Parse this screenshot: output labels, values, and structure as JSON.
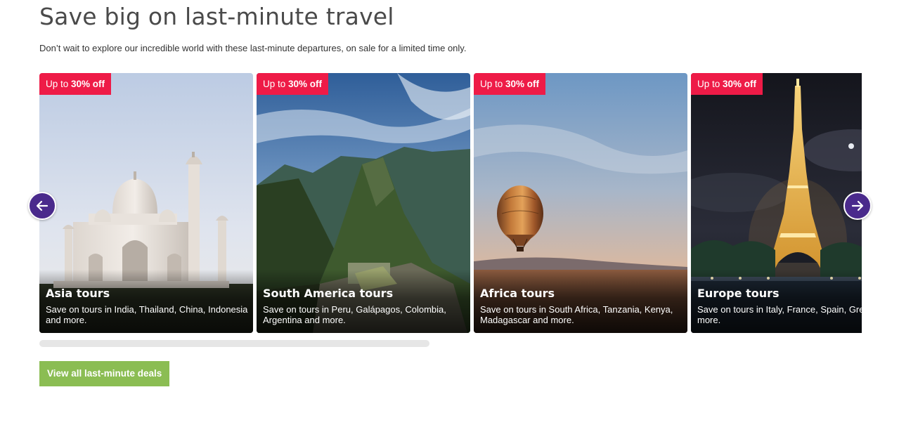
{
  "section": {
    "title": "Save big on last-minute travel",
    "subtitle": "Don’t wait to explore our incredible world with these last-minute departures, on sale for a limited time only."
  },
  "colors": {
    "badge": "#ee1b47",
    "arrow": "#4a2a8c",
    "cta": "#8bbd53",
    "scrollbar": "#e6e6e6"
  },
  "carousel": {
    "prev_icon": "arrow-left-icon",
    "next_icon": "arrow-right-icon",
    "cards": [
      {
        "badge_prefix": "Up to ",
        "badge_amount": "30% off",
        "title": "Asia tours",
        "description": "Save on tours in India, Thailand, China, Indonesia and more.",
        "image": "Taj Mahal"
      },
      {
        "badge_prefix": "Up to ",
        "badge_amount": "30% off",
        "title": "South America tours",
        "description": "Save on tours in Peru, Galápagos, Colombia, Argentina and more.",
        "image": "Machu Picchu"
      },
      {
        "badge_prefix": "Up to ",
        "badge_amount": "30% off",
        "title": "Africa tours",
        "description": "Save on tours in South Africa, Tanzania, Kenya, Madagascar and more.",
        "image": "Hot air balloon over savanna"
      },
      {
        "badge_prefix": "Up to ",
        "badge_amount": "30% off",
        "title": "Europe tours",
        "description": "Save on tours in Italy, France, Spain, Greece and more.",
        "image": "Eiffel Tower at night"
      }
    ]
  },
  "cta": {
    "label": "View all last-minute deals"
  }
}
